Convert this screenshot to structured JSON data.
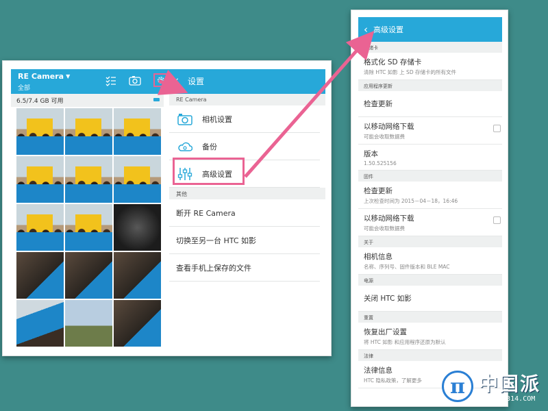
{
  "left_screen": {
    "app_name": "RE Camera",
    "app_filter": "全部",
    "storage": "6.5/7.4 GB 可用",
    "settings_title": "设置",
    "sections": [
      {
        "label": "RE Camera",
        "items": [
          {
            "label": "相机设置",
            "icon": "camera-icon"
          },
          {
            "label": "备份",
            "icon": "cloud-icon"
          },
          {
            "label": "高级设置",
            "icon": "sliders-icon"
          }
        ]
      },
      {
        "label": "其他",
        "items": [
          {
            "label": "断开 RE Camera"
          },
          {
            "label": "切换至另一台 HTC 如影"
          },
          {
            "label": "查看手机上保存的文件"
          }
        ]
      }
    ],
    "photos": [
      "banner",
      "banner",
      "banner",
      "banner",
      "banner",
      "banner",
      "banner",
      "banner",
      "dark",
      "people",
      "people",
      "people",
      "blue",
      "tree",
      "people"
    ]
  },
  "right_screen": {
    "title": "高级设置",
    "sections": [
      {
        "label": "存储卡",
        "items": [
          {
            "main": "格式化 SD 存储卡",
            "sub": "清除 HTC 如影 上 SD 存储卡的所有文件",
            "checkbox": false
          }
        ]
      },
      {
        "label": "应用程序更新",
        "items": [
          {
            "main": "检查更新",
            "sub": "",
            "checkbox": false
          },
          {
            "main": "以移动网络下载",
            "sub": "可能会收取数据费",
            "checkbox": true
          },
          {
            "main": "版本",
            "sub": "1.50.525156",
            "checkbox": false
          }
        ]
      },
      {
        "label": "固件",
        "items": [
          {
            "main": "检查更新",
            "sub": "上次检查时间为 2015－04－18，16:46",
            "checkbox": false
          },
          {
            "main": "以移动网络下载",
            "sub": "可能会收取数据费",
            "checkbox": true
          }
        ]
      },
      {
        "label": "关于",
        "items": [
          {
            "main": "相机信息",
            "sub": "名称、序列号、固件版本和 BLE MAC",
            "checkbox": false
          }
        ]
      },
      {
        "label": "电源",
        "items": [
          {
            "main": "关闭 HTC 如影",
            "sub": "",
            "checkbox": false
          }
        ]
      },
      {
        "label": "重置",
        "items": [
          {
            "main": "恢复出厂设置",
            "sub": "将 HTC 如影 和应用程序还原为默认",
            "checkbox": false
          }
        ]
      },
      {
        "label": "法律",
        "items": [
          {
            "main": "法律信息",
            "sub": "HTC 隐私政策，了解更多",
            "checkbox": false
          }
        ]
      }
    ]
  },
  "watermark": {
    "title": "中国派",
    "url": "BBS.CN314.COM"
  },
  "colors": {
    "background": "#3e8b89",
    "accent": "#27a8d9",
    "highlight": "#ea6393"
  }
}
